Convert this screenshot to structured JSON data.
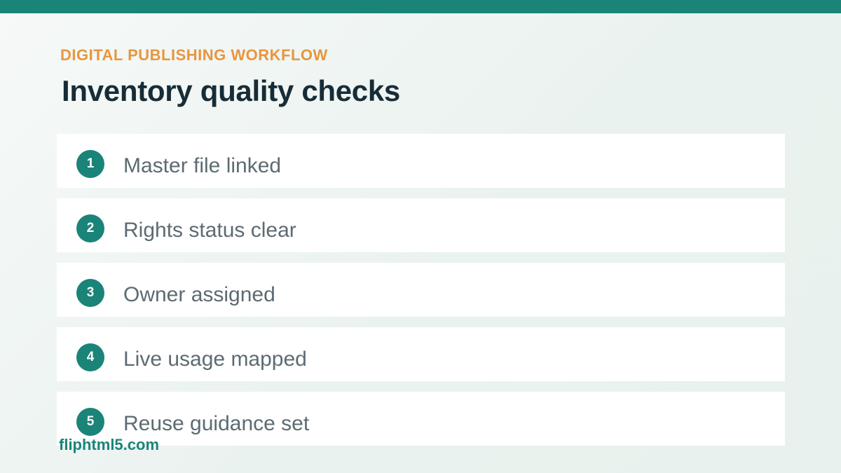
{
  "header": {
    "eyebrow": "DIGITAL PUBLISHING WORKFLOW",
    "title": "Inventory quality checks"
  },
  "checks": [
    {
      "number": "1",
      "label": "Master file linked"
    },
    {
      "number": "2",
      "label": "Rights status clear"
    },
    {
      "number": "3",
      "label": "Owner assigned"
    },
    {
      "number": "4",
      "label": "Live usage mapped"
    },
    {
      "number": "5",
      "label": "Reuse guidance set"
    }
  ],
  "watermark": "fliphtml5.com",
  "colors": {
    "accent": "#1a8479",
    "eyebrow": "#e8963f",
    "title": "#172c36",
    "item_text": "#5c6b72"
  }
}
